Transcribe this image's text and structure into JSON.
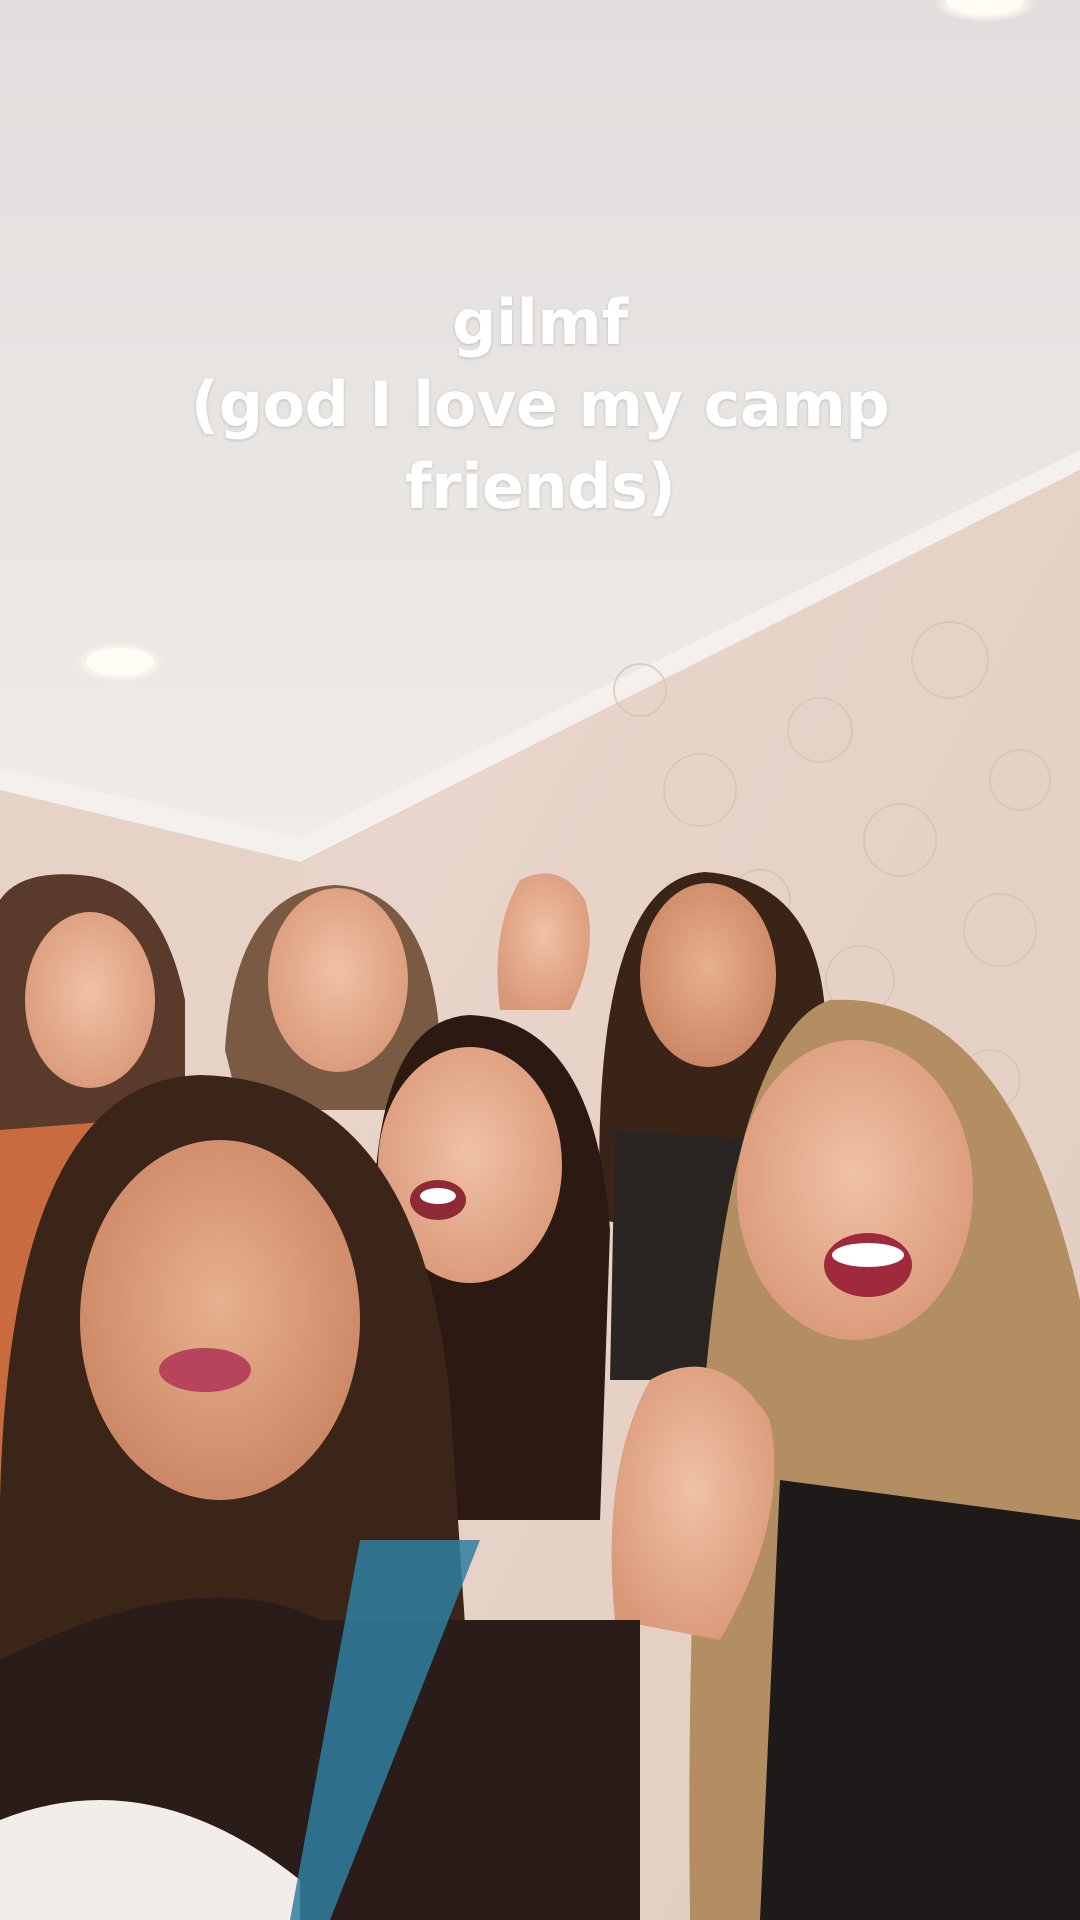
{
  "caption": {
    "line1": "gilmf",
    "line2": "(god I love my camp",
    "line3": "friends)"
  },
  "colors": {
    "ceiling": "#ece8e6",
    "wall": "#e8d3c8",
    "crown_molding": "#f3efec",
    "ceiling_light": "#fffdf6",
    "caption_text": "#ffffff"
  }
}
